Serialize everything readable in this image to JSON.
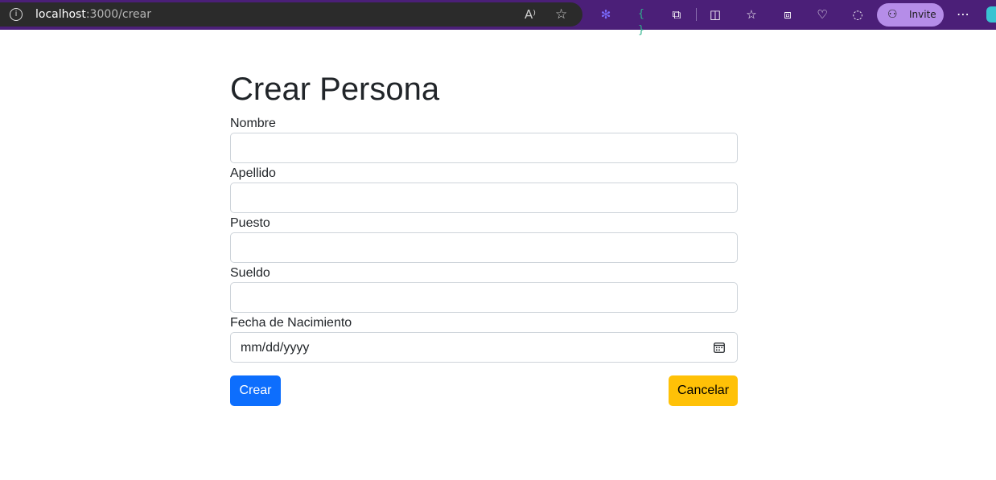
{
  "browser": {
    "url_host": "localhost",
    "url_path": ":3000/crear",
    "info_icon": "info-icon",
    "read_aloud_icon": "read-aloud-icon",
    "favorite_icon": "favorite-star-icon",
    "invite_label": "Invite",
    "colors": {
      "bar": "#4b1f78",
      "address": "#2b2b2b",
      "invite": "#b58de8"
    }
  },
  "form": {
    "title": "Crear Persona",
    "fields": [
      {
        "label": "Nombre",
        "value": ""
      },
      {
        "label": "Apellido",
        "value": ""
      },
      {
        "label": "Puesto",
        "value": ""
      },
      {
        "label": "Sueldo",
        "value": ""
      },
      {
        "label": "Fecha de Nacimiento",
        "value": "",
        "placeholder": "mm/dd/yyyy"
      }
    ],
    "submit_label": "Crear",
    "cancel_label": "Cancelar",
    "colors": {
      "primary": "#0d6efd",
      "warning": "#ffc107"
    }
  }
}
